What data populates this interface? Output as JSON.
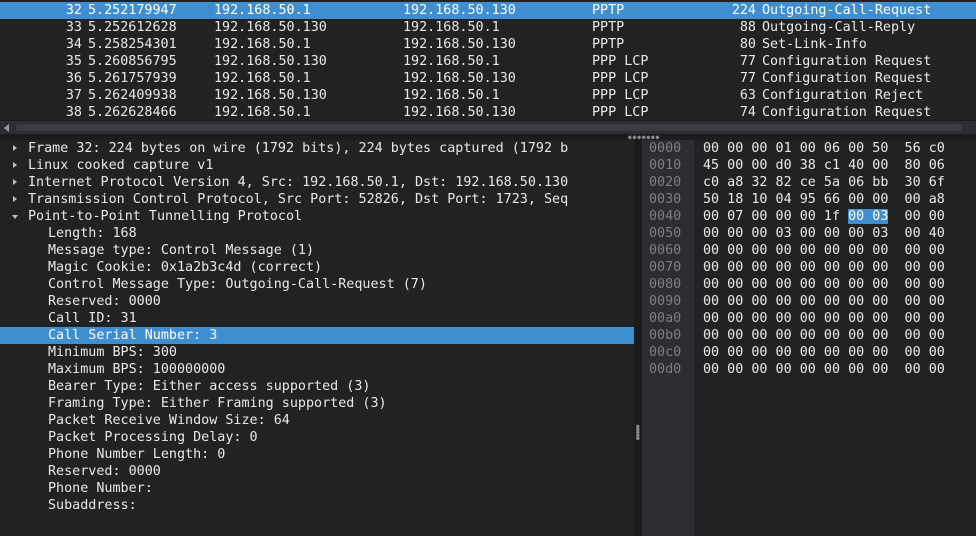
{
  "packets": [
    {
      "no": "32",
      "time": "5.252179947",
      "src": "192.168.50.1",
      "dst": "192.168.50.130",
      "proto": "PPTP",
      "len": "224",
      "info": "Outgoing-Call-Request",
      "selected": true
    },
    {
      "no": "33",
      "time": "5.252612628",
      "src": "192.168.50.130",
      "dst": "192.168.50.1",
      "proto": "PPTP",
      "len": "88",
      "info": "Outgoing-Call-Reply",
      "selected": false
    },
    {
      "no": "34",
      "time": "5.258254301",
      "src": "192.168.50.1",
      "dst": "192.168.50.130",
      "proto": "PPTP",
      "len": "80",
      "info": "Set-Link-Info",
      "selected": false
    },
    {
      "no": "35",
      "time": "5.260856795",
      "src": "192.168.50.130",
      "dst": "192.168.50.1",
      "proto": "PPP LCP",
      "len": "77",
      "info": "Configuration Request",
      "selected": false
    },
    {
      "no": "36",
      "time": "5.261757939",
      "src": "192.168.50.1",
      "dst": "192.168.50.130",
      "proto": "PPP LCP",
      "len": "77",
      "info": "Configuration Request",
      "selected": false
    },
    {
      "no": "37",
      "time": "5.262409938",
      "src": "192.168.50.130",
      "dst": "192.168.50.1",
      "proto": "PPP LCP",
      "len": "63",
      "info": "Configuration Reject",
      "selected": false
    },
    {
      "no": "38",
      "time": "5.262628466",
      "src": "192.168.50.1",
      "dst": "192.168.50.130",
      "proto": "PPP LCP",
      "len": "74",
      "info": "Configuration Request",
      "selected": false
    }
  ],
  "tree": [
    {
      "text": "Frame 32: 224 bytes on wire (1792 bits), 224 bytes captured (1792 b",
      "level": 0,
      "expander": "collapsed",
      "selected": false
    },
    {
      "text": "Linux cooked capture v1",
      "level": 0,
      "expander": "collapsed",
      "selected": false
    },
    {
      "text": "Internet Protocol Version 4, Src: 192.168.50.1, Dst: 192.168.50.130",
      "level": 0,
      "expander": "collapsed",
      "selected": false
    },
    {
      "text": "Transmission Control Protocol, Src Port: 52826, Dst Port: 1723, Seq",
      "level": 0,
      "expander": "collapsed",
      "selected": false
    },
    {
      "text": "Point-to-Point Tunnelling Protocol",
      "level": 0,
      "expander": "expanded",
      "selected": false
    },
    {
      "text": "Length: 168",
      "level": 1,
      "expander": "none",
      "selected": false
    },
    {
      "text": "Message type: Control Message (1)",
      "level": 1,
      "expander": "none",
      "selected": false
    },
    {
      "text": "Magic Cookie: 0x1a2b3c4d (correct)",
      "level": 1,
      "expander": "none",
      "selected": false
    },
    {
      "text": "Control Message Type: Outgoing-Call-Request (7)",
      "level": 1,
      "expander": "none",
      "selected": false
    },
    {
      "text": "Reserved: 0000",
      "level": 1,
      "expander": "none",
      "selected": false
    },
    {
      "text": "Call ID: 31",
      "level": 1,
      "expander": "none",
      "selected": false
    },
    {
      "text": "Call Serial Number: 3",
      "level": 1,
      "expander": "none",
      "selected": true
    },
    {
      "text": "Minimum BPS: 300",
      "level": 1,
      "expander": "none",
      "selected": false
    },
    {
      "text": "Maximum BPS: 100000000",
      "level": 1,
      "expander": "none",
      "selected": false
    },
    {
      "text": "Bearer Type: Either access supported (3)",
      "level": 1,
      "expander": "none",
      "selected": false
    },
    {
      "text": "Framing Type: Either Framing supported (3)",
      "level": 1,
      "expander": "none",
      "selected": false
    },
    {
      "text": "Packet Receive Window Size: 64",
      "level": 1,
      "expander": "none",
      "selected": false
    },
    {
      "text": "Packet Processing Delay: 0",
      "level": 1,
      "expander": "none",
      "selected": false
    },
    {
      "text": "Phone Number Length: 0",
      "level": 1,
      "expander": "none",
      "selected": false
    },
    {
      "text": "Reserved: 0000",
      "level": 1,
      "expander": "none",
      "selected": false
    },
    {
      "text": "Phone Number:",
      "level": 1,
      "expander": "none",
      "selected": false
    },
    {
      "text": "Subaddress:",
      "level": 1,
      "expander": "none",
      "selected": false
    }
  ],
  "bytes": [
    {
      "offset": "0000",
      "pre": "00 00 00 01 00 06 00 50  56 c0",
      "hl": "",
      "post": ""
    },
    {
      "offset": "0010",
      "pre": "45 00 00 d0 38 c1 40 00  80 06",
      "hl": "",
      "post": ""
    },
    {
      "offset": "0020",
      "pre": "c0 a8 32 82 ce 5a 06 bb  30 6f",
      "hl": "",
      "post": ""
    },
    {
      "offset": "0030",
      "pre": "50 18 10 04 95 66 00 00  00 a8",
      "hl": "",
      "post": ""
    },
    {
      "offset": "0040",
      "pre": "00 07 00 00 00 1f ",
      "hl": "00 03",
      "post": "  00 00"
    },
    {
      "offset": "0050",
      "pre": "00 00 00 03 00 00 00 03  00 40",
      "hl": "",
      "post": ""
    },
    {
      "offset": "0060",
      "pre": "00 00 00 00 00 00 00 00  00 00",
      "hl": "",
      "post": ""
    },
    {
      "offset": "0070",
      "pre": "00 00 00 00 00 00 00 00  00 00",
      "hl": "",
      "post": ""
    },
    {
      "offset": "0080",
      "pre": "00 00 00 00 00 00 00 00  00 00",
      "hl": "",
      "post": ""
    },
    {
      "offset": "0090",
      "pre": "00 00 00 00 00 00 00 00  00 00",
      "hl": "",
      "post": ""
    },
    {
      "offset": "00a0",
      "pre": "00 00 00 00 00 00 00 00  00 00",
      "hl": "",
      "post": ""
    },
    {
      "offset": "00b0",
      "pre": "00 00 00 00 00 00 00 00  00 00",
      "hl": "",
      "post": ""
    },
    {
      "offset": "00c0",
      "pre": "00 00 00 00 00 00 00 00  00 00",
      "hl": "",
      "post": ""
    },
    {
      "offset": "00d0",
      "pre": "00 00 00 00 00 00 00 00  00 00",
      "hl": "",
      "post": ""
    }
  ],
  "icons": {
    "scroll_left": "arrow-left-icon",
    "expand_collapsed": "triangle-right-icon",
    "expand_expanded": "triangle-down-icon",
    "splitter_grip": "grip-icon"
  },
  "colors": {
    "selection": "#3e8ed0",
    "background": "#202224",
    "offset_column": "#2b2d30",
    "offset_text": "#7d7f82"
  }
}
